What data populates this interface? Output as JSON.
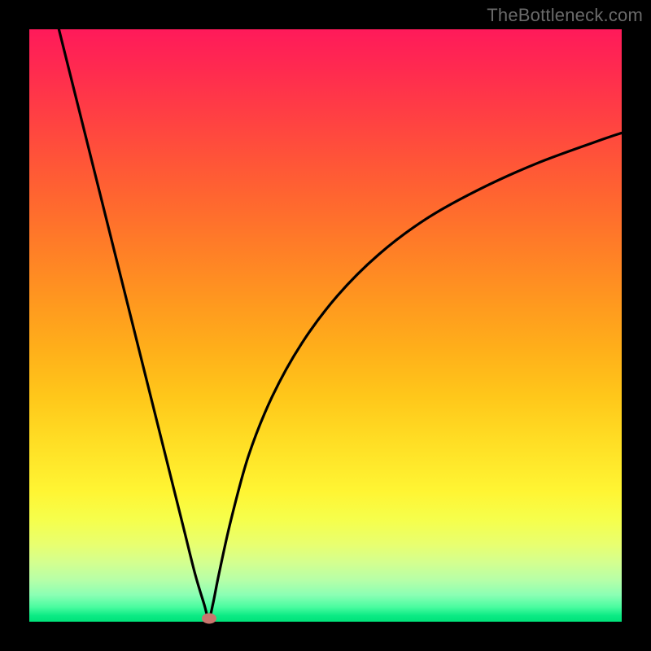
{
  "watermark": "TheBottleneck.com",
  "chart_data": {
    "type": "line",
    "title": "",
    "xlabel": "",
    "ylabel": "",
    "xlim": [
      0,
      100
    ],
    "ylim": [
      0,
      100
    ],
    "background_gradient": [
      "#ff1a5a",
      "#ff6a2e",
      "#ffc71a",
      "#fff533",
      "#8affb4",
      "#00e27a"
    ],
    "series": [
      {
        "name": "bottleneck-curve",
        "x": [
          5,
          8,
          11,
          14,
          17,
          20,
          23,
          26,
          28,
          29.5,
          30.3,
          31,
          32,
          34,
          37,
          41,
          46,
          52,
          59,
          67,
          76,
          86,
          97,
          100
        ],
        "y": [
          100,
          88,
          76,
          64,
          52,
          40,
          28,
          16,
          8,
          3,
          0.5,
          3,
          8,
          17,
          28,
          38,
          47,
          55,
          62,
          68,
          73,
          77.5,
          81.5,
          82.5
        ]
      }
    ],
    "marker": {
      "x": 30.3,
      "y": 0.5,
      "color": "#c9766e"
    },
    "colors": {
      "curve": "#000000",
      "frame": "#000000",
      "marker": "#c9766e"
    }
  }
}
